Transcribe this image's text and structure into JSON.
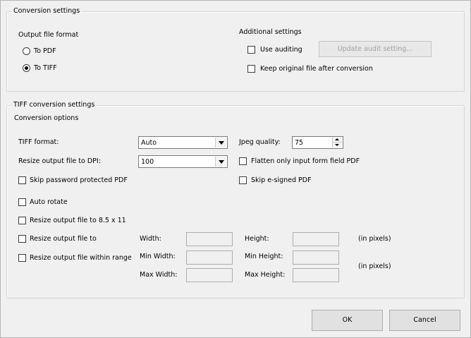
{
  "conversion_settings": {
    "legend": "Conversion settings",
    "output_format_label": "Output file format",
    "radio_pdf": "To PDF",
    "radio_tiff": "To TIFF",
    "selected_format": "To TIFF",
    "additional_label": "Additional settings",
    "use_auditing": "Use auditing",
    "use_auditing_checked": false,
    "update_audit_button": "Update audit setting...",
    "keep_original": "Keep original file after conversion",
    "keep_original_checked": false
  },
  "tiff_settings": {
    "legend": "TIFF conversion settings",
    "options_label": "Conversion options",
    "tiff_format_label": "TIFF format:",
    "tiff_format_value": "Auto",
    "jpeg_quality_label": "Jpeg quality:",
    "jpeg_quality_value": "75",
    "resize_dpi_label": "Resize output file to DPI:",
    "resize_dpi_value": "100",
    "flatten_label": "Flatten only input form field PDF",
    "skip_password_label": "Skip password protected PDF",
    "skip_esigned_label": "Skip e-signed PDF",
    "auto_rotate_label": "Auto rotate",
    "resize_85_label": "Resize output file to 8.5 x 11",
    "resize_to_label": "Resize output file to",
    "resize_range_label": "Resize output file within range",
    "width_label": "Width:",
    "height_label": "Height:",
    "in_pixels_1": "(in pixels)",
    "min_width_label": "Min Width:",
    "min_height_label": "Min Height:",
    "max_width_label": "Max Width:",
    "max_height_label": "Max Height:",
    "in_pixels_2": "(in pixels)"
  },
  "footer": {
    "ok": "OK",
    "cancel": "Cancel"
  }
}
